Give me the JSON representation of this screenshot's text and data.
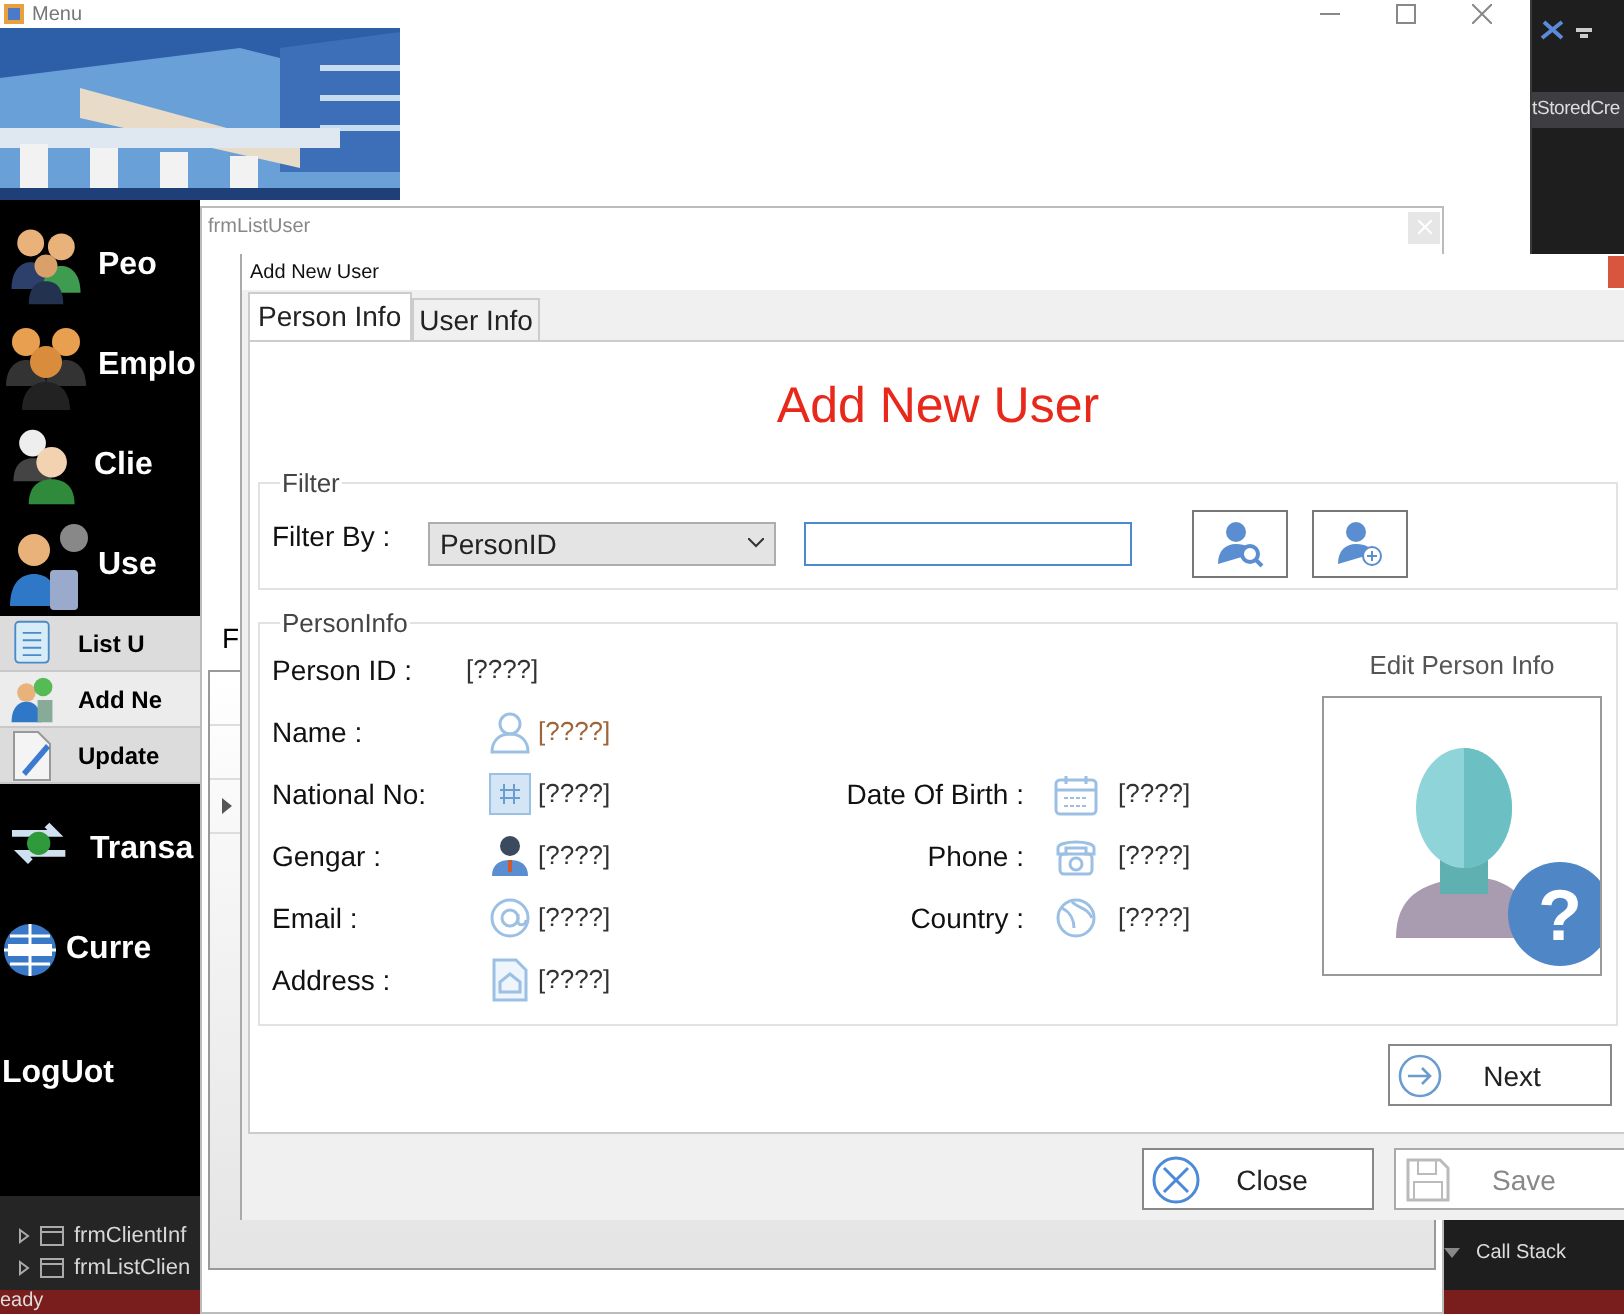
{
  "menu_window": {
    "title": "Menu",
    "sidebar": [
      {
        "label": "Peo"
      },
      {
        "label": "Emplo"
      },
      {
        "label": "Clie"
      },
      {
        "label": "Use",
        "submenu": [
          {
            "label": "List U",
            "selected": false
          },
          {
            "label": "Add Ne",
            "selected": true
          },
          {
            "label": "Update",
            "selected": false
          }
        ]
      },
      {
        "label": "Transa"
      },
      {
        "label": "Curre"
      },
      {
        "label": "LogUot"
      }
    ]
  },
  "ide": {
    "tab": "tStoredCre",
    "call_stack": "Call Stack",
    "solution_items": [
      "frmClientInf",
      "frmListClien"
    ],
    "status_bar": "eady"
  },
  "list_window": {
    "title": "frmListUser",
    "label": "F"
  },
  "add_user_window": {
    "title": "Add New User",
    "tabs": [
      {
        "label": "Person Info",
        "selected": true
      },
      {
        "label": "User Info",
        "selected": false
      }
    ],
    "heading": "Add New User",
    "filter": {
      "title": "Filter",
      "label": "Filter By :",
      "selected_option": "PersonID"
    },
    "person_info": {
      "title": "PersonInfo",
      "edit_link": "Edit Person Info",
      "photo_badge": "?",
      "rows": [
        {
          "left": {
            "label": "Person ID :",
            "value": "[????]",
            "color": "#333333"
          }
        },
        {
          "left": {
            "label": "Name :",
            "value": "[????]",
            "color": "#a0643c"
          }
        },
        {
          "left": {
            "label": "National No:",
            "value": "[????]",
            "color": "#333333"
          },
          "right": {
            "label": "Date Of Birth :",
            "value": "[????]",
            "color": "#333333"
          }
        },
        {
          "left": {
            "label": "Gengar :",
            "value": "[????]",
            "color": "#333333"
          },
          "right": {
            "label": "Phone :",
            "value": "[????]",
            "color": "#333333"
          }
        },
        {
          "left": {
            "label": "Email :",
            "value": "[????]",
            "color": "#333333"
          },
          "right": {
            "label": "Country :",
            "value": "[????]",
            "color": "#333333"
          }
        },
        {
          "left": {
            "label": "Address :",
            "value": "[????]",
            "color": "#333333"
          }
        }
      ]
    },
    "next_button": {
      "label": "Next"
    },
    "close_button": {
      "label": "Close"
    },
    "save_button": {
      "label": "Save",
      "disabled": true
    }
  }
}
